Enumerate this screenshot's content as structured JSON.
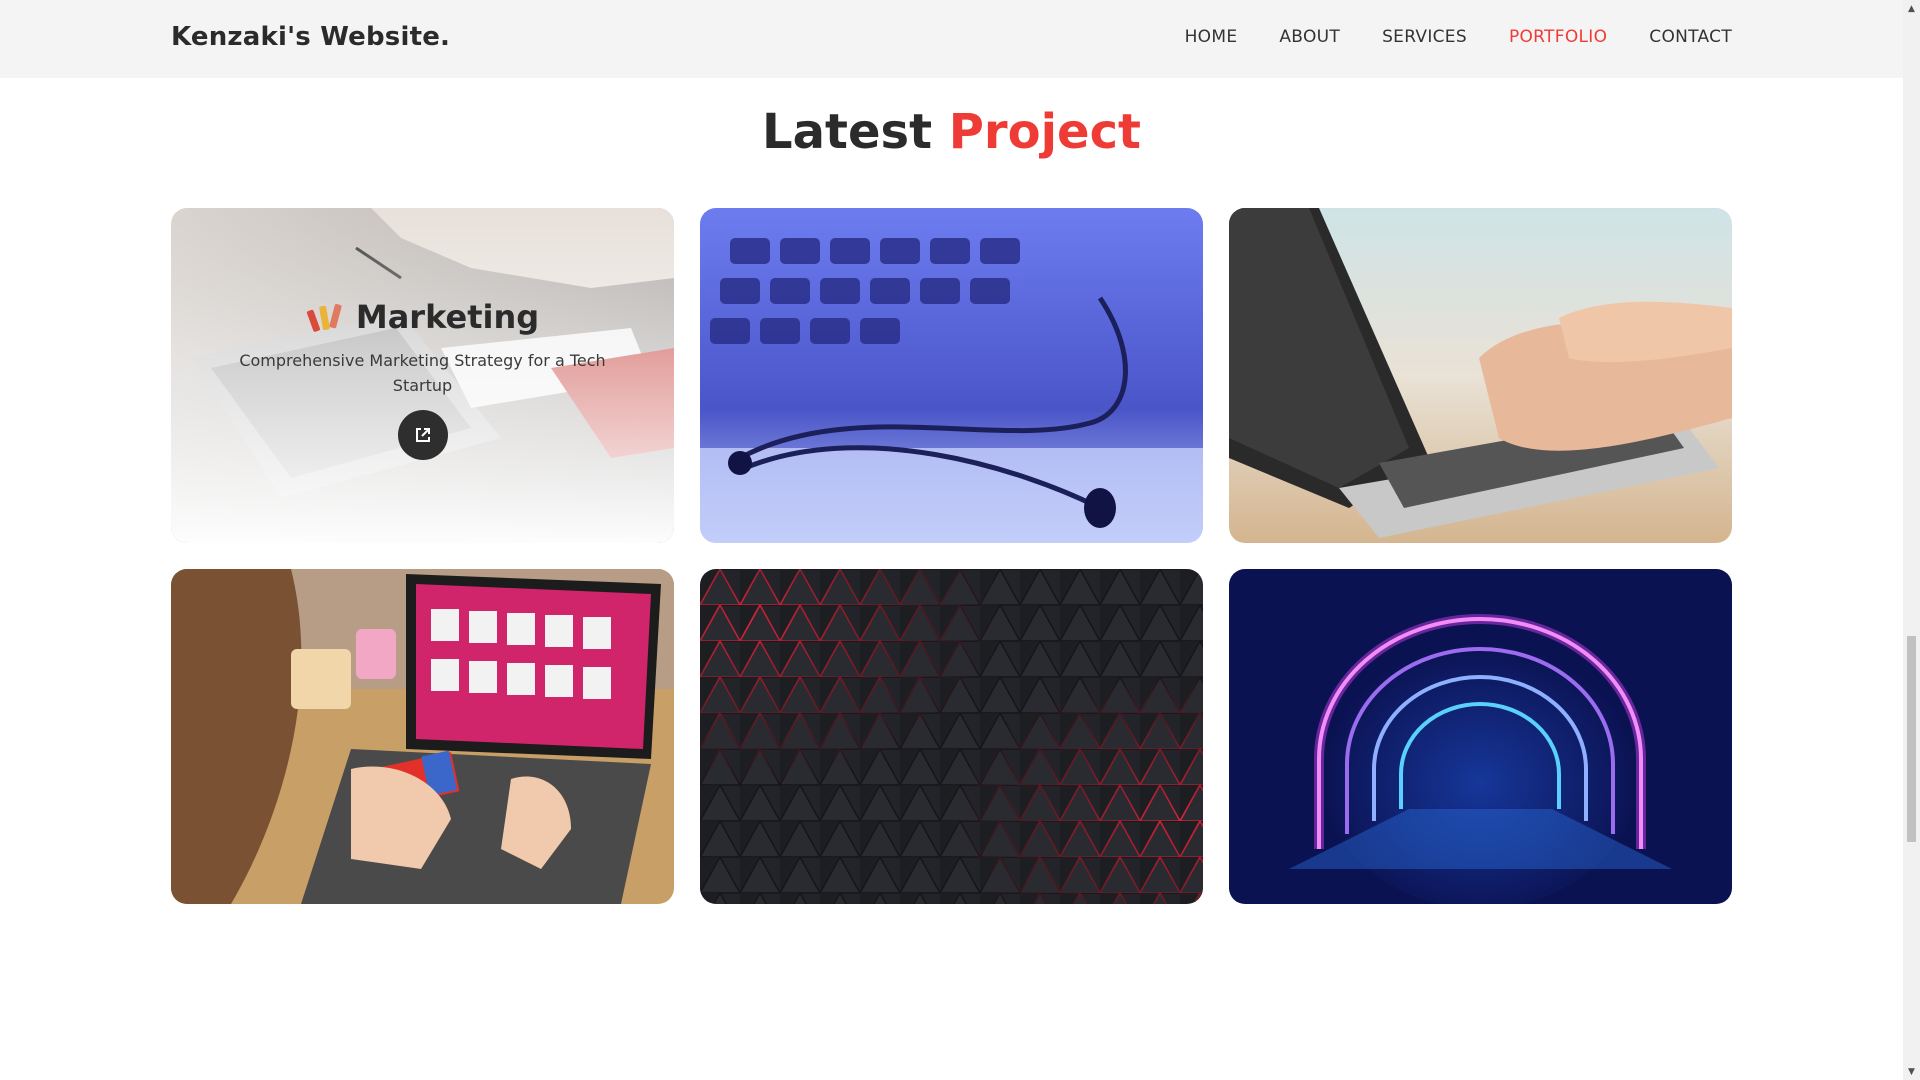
{
  "header": {
    "brand": "Kenzaki's Website.",
    "nav": [
      {
        "label": "HOME",
        "active": false
      },
      {
        "label": "ABOUT",
        "active": false
      },
      {
        "label": "SERVICES",
        "active": false
      },
      {
        "label": "PORTFOLIO",
        "active": true
      },
      {
        "label": "CONTACT",
        "active": false
      }
    ]
  },
  "section": {
    "title_part1": "Latest",
    "title_part2": "Project"
  },
  "projects": [
    {
      "image": "laptop-notebook-photo",
      "title": "Marketing",
      "description": "Comprehensive Marketing Strategy for a Tech Startup",
      "link_icon": "external-link-icon"
    },
    {
      "image": "stethoscope-keyboard-photo"
    },
    {
      "image": "hands-typing-laptop-photo"
    },
    {
      "image": "online-shopping-laptop-photo"
    },
    {
      "image": "dark-triangle-red-glow-pattern"
    },
    {
      "image": "neon-arch-tunnel"
    }
  ],
  "colors": {
    "accent": "#ef3b36",
    "header_bg": "#f4f4f4",
    "text": "#2b2b2b"
  }
}
